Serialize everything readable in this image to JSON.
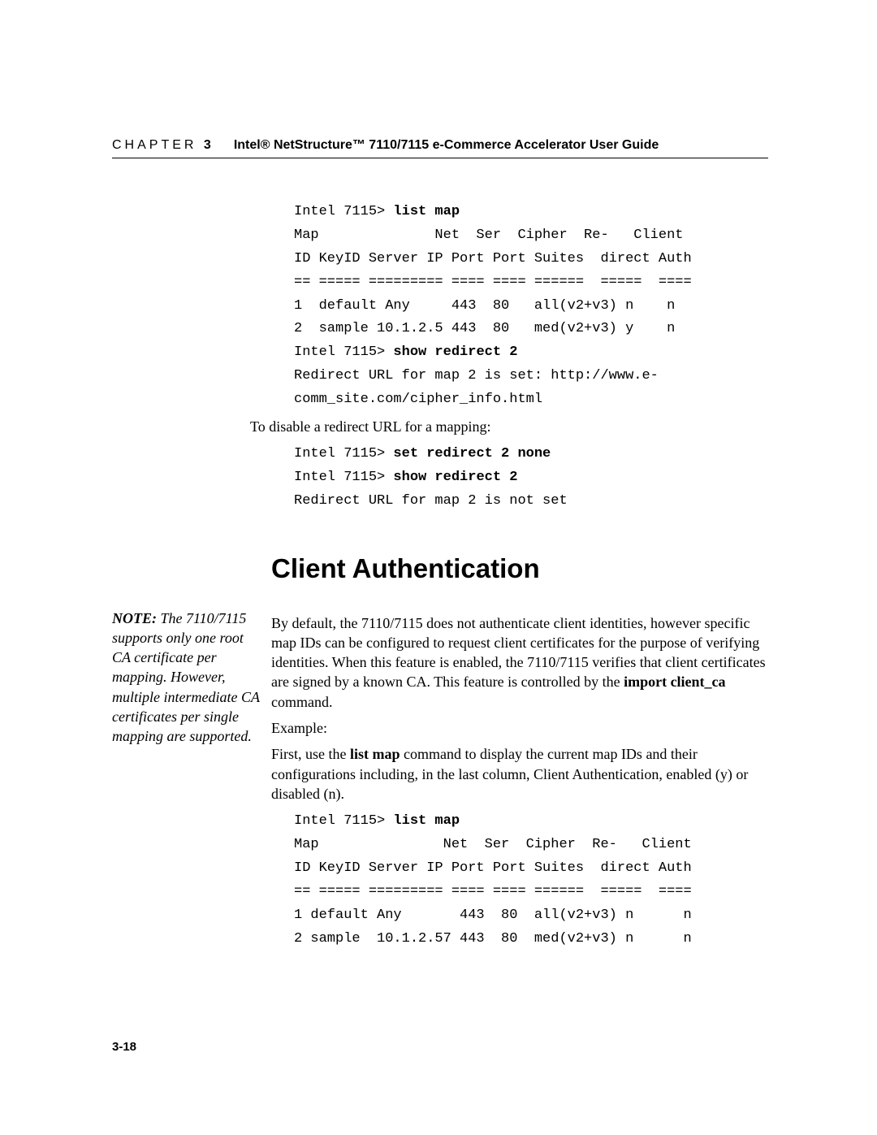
{
  "header": {
    "chapter_word": "CHAPTER",
    "chapter_num": "3",
    "title": "Intel® NetStructure™ 7110/7115 e-Commerce Accelerator User Guide"
  },
  "block1_prompt1": "Intel 7115> ",
  "block1_cmd1": "list map",
  "block1_hdr1": "Map              Net  Ser  Cipher  Re-   Client",
  "block1_hdr2": "ID KeyID Server IP Port Port Suites  direct Auth",
  "block1_sep": "== ===== ========= ==== ==== ======  =====  ====",
  "block1_row1": "1  default Any     443  80   all(v2+v3) n    n",
  "block1_row2": "2  sample 10.1.2.5 443  80   med(v2+v3) y    n",
  "block1_prompt2": "Intel 7115> ",
  "block1_cmd2": "show redirect 2",
  "block1_out1": "Redirect URL for map 2 is set: http://www.e-\ncomm_site.com/cipher_info.html",
  "para_disable": "To disable a redirect URL for a mapping:",
  "block2_prompt1": "Intel 7115> ",
  "block2_cmd1": "set redirect 2 none",
  "block2_prompt2": "Intel 7115> ",
  "block2_cmd2": "show redirect 2",
  "block2_out1": "Redirect URL for map 2 is not set",
  "section_heading": "Client Authentication",
  "note_lead": "NOTE:",
  "note_body": "  The 7110/7115 supports only one root CA certificate per mapping. However, multiple intermediate CA certificates per single mapping are supported.",
  "para_auth_1": "By default, the 7110/7115 does not authenticate client identities, however specific map IDs can be configured to request client certificates for the purpose of verifying identities. When this feature is enabled, the 7110/7115 verifies that client certificates are signed by a known CA. This feature is controlled by the ",
  "para_auth_cmd": "import client_ca",
  "para_auth_2": " command.",
  "para_example": "Example:",
  "para_first_1": "First, use the ",
  "para_first_cmd": "list map",
  "para_first_2": " command to display the current map IDs and their configurations including, in the last column, Client Authentication, enabled (y) or disabled (n).",
  "block3_prompt1": "Intel 7115> ",
  "block3_cmd1": "list map",
  "block3_hdr1": "Map               Net  Ser  Cipher  Re-   Client",
  "block3_hdr2": "ID KeyID Server IP Port Port Suites  direct Auth",
  "block3_sep": "== ===== ========= ==== ==== ======  =====  ====",
  "block3_row1": "1 default Any       443  80  all(v2+v3) n      n",
  "block3_row2": "2 sample  10.1.2.57 443  80  med(v2+v3) n      n",
  "page_number": "3-18"
}
